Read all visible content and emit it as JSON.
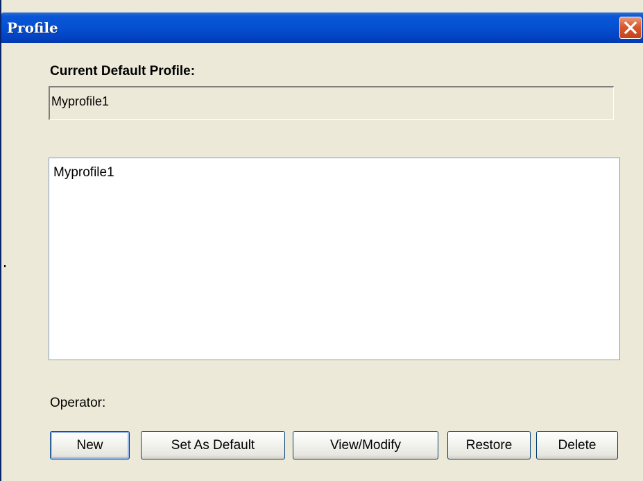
{
  "window": {
    "title": "Profile"
  },
  "current_default": {
    "label": "Current Default Profile:",
    "value": "Myprofile1"
  },
  "profiles": {
    "items": [
      "Myprofile1"
    ]
  },
  "operator": {
    "label": "Operator:"
  },
  "buttons": {
    "new": "New",
    "set_default": "Set As Default",
    "view_modify": "View/Modify",
    "restore": "Restore",
    "delete": "Delete"
  },
  "icons": {
    "close": "close-icon"
  },
  "colors": {
    "titlebar": "#0452d2",
    "close": "#d8582e",
    "dialog_bg": "#ece9d8"
  }
}
